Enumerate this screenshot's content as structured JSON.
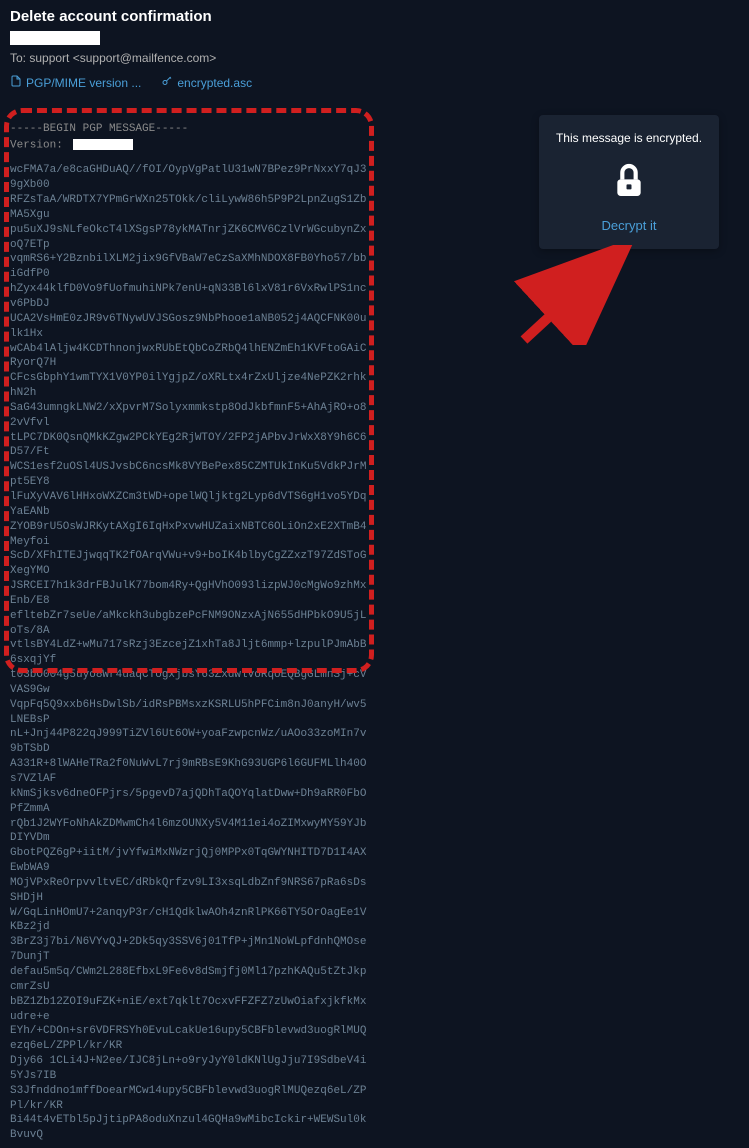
{
  "header": {
    "subject": "Delete account confirmation",
    "to_label": "To:",
    "to_value": "support <support@mailfence.com>"
  },
  "attachments": {
    "pgp_mime": "PGP/MIME version ...",
    "encrypted_asc": "encrypted.asc"
  },
  "pgp": {
    "begin_marker": "-----BEGIN PGP MESSAGE-----",
    "version_label": "Version:",
    "body": "wcFMA7a/e8caGHDuAQ//fOI/OypVgPatlU31wN7BPez9PrNxxY7qJ39gXb00\nRFZsTaA/WRDTX7YPmGrWXn25TOkk/cliLywW86h5P9P2LpnZugS1ZbMA5Xgu\npu5uXJ9sNLfeOkcT4lXSgsP78ykMATnrjZK6CMV6CzlVrWGcubynZxoQ7ETp\nvqmRS6+Y2BznbilXLM2jix9GfVBaW7eCzSaXMhNDOX8FB0Yho57/bbiGdfP0\nhZyx44klfD0Vo9fUofmuhiNPk7enU+qN33Bl6lxV81r6VxRwlPS1ncv6PbDJ\nUCA2VsHmE0zJR9v6TNywUVJSGosz9NbPhooe1aNB052j4AQCFNK00ulk1Hx\nwCAb4lAljw4KCDThnonjwxRUbEtQbCoZRbQ4lhENZmEh1KVFtoGAiCRyorQ7H\nCFcsGbphY1wmTYX1V0YP0ilYgjpZ/oXRLtx4rZxUljze4NePZK2rhkhN2h\nSaG43umngkLNW2/xXpvrM7Solyxmmkstp8OdJkbfmnF5+AhAjRO+o82vVfvl\ntLPC7DK0QsnQMkKZgw2PCkYEg2RjWTOY/2FP2jAPbvJrWxX8Y9h6C6D57/Ft\nWCS1esf2uOSl4USJvsbC6ncsMk8VYBePex85CZMTUkInKu5VdkPJrMpt5EY8\nlFuXyVAV6lHHxoWXZCm3tWD+opelWQljktg2Lyp6dVTS6gH1vo5YDqYaEANb\nZYOB9rU5OsWJRKytAXgI6IqHxPxvwHUZaixNBTC6OLiOn2xE2XTmB4Meyfoi\nScD/XFhITEJjwqqTK2fOArqVWu+v9+boIK4blbyCgZZxzT97ZdSToGXegYMO\nJSRCEI7h1k3drFBJulK77bom4Ry+QgHVhO093lizpWJ0cMgWo9zhMxEnb/E8\nefltebZr7seUe/aMkckh3ubgbzePcFNM9ONzxAjN655dHPbkO9U5jLoTs/8A\nvtlsBY4LdZ+wMu717sRzj3EzcejZ1xhTa8Jljt6mmp+lzpulPJmAbB6sxqjYf\nt03bO004g5uyo8Wr4uaqCTogxjbsY63ZxdwlvoRqoEQBgGLmnSj+cVVAS9Gw\nVqpFq5Q9xxb6HsDwlSb/idRsPBMsxzKSRLU5hPFCim8nJ0anyH/wv5LNEBsP\nnL+Jnj44P822qJ999TiZVl6Ut6OW+yoaFzwpcnWz/uAOo33zoMIn7v9bTSbD\nA331R+8lWAHeTRa2f0NuWvL7rj9mRBsE9KhG93UGP6l6GUFMLlh40Os7VZlAF\nkNmSjksv6dneOFPjrs/5pgevD7ajQDhTaQOYqlatDww+Dh9aRR0FbOPfZmmA\nrQb1J2WYFoNhAkZDMwmCh4l6mzOUNXy5V4M11ei4oZIMxwyMY59YJbDIYVDm\nGbotPQZ6gP+iitM/jvYfwiMxNWzrjQj0MPPx0TqGWYNHITD7D1I4AXEwbWA9\nMOjVPxReOrpvvltvEC/dRbkQrfzv9LI3xsqLdbZnf9NRS67pRa6sDsSHDjH\nW/GqLinHOmU7+2anqyP3r/cH1QdklwAOh4znRlPK66TY5OrOagEe1VKBz2jd\n3BrZ3j7bi/N6VYvQJ+2Dk5qy3SSV6j01TfP+jMn1NoWLpfdnhQMOse7DunjT\ndefau5m5q/CWm2L288EfbxL9Fe6v8dSmjfj0Ml17pzhKAQu5tZtJkpcmrZsU\nbBZ1Zb12ZOI9uFZK+niE/ext7qklt7OcxvFFZFZ7zUwOiafxjkfkMxudre+e\nEYh/+CDOn+sr6VDFRSYh0EvuLcakUe16upy5CBFblevwd3uogRlMUQezq6eL/ZPPl/kr/KR\nDjy66 1CLi4J+N2ee/IJC8jLn+o9ryJyY0ldKNlUgJju7I9SdbeV4i5YJs7IB\nS3Jfnddno1mffDoearMCw14upy5CBFblevwd3uogRlMUQezq6eL/ZPPl/kr/KR\nBi44t4vETbl5pJjtipPA8oduXnzul4GQHa9wMibcIckir+WEWSul0kBvuvQ"
  },
  "encrypted_box": {
    "message": "This message is encrypted.",
    "decrypt_label": "Decrypt it"
  }
}
